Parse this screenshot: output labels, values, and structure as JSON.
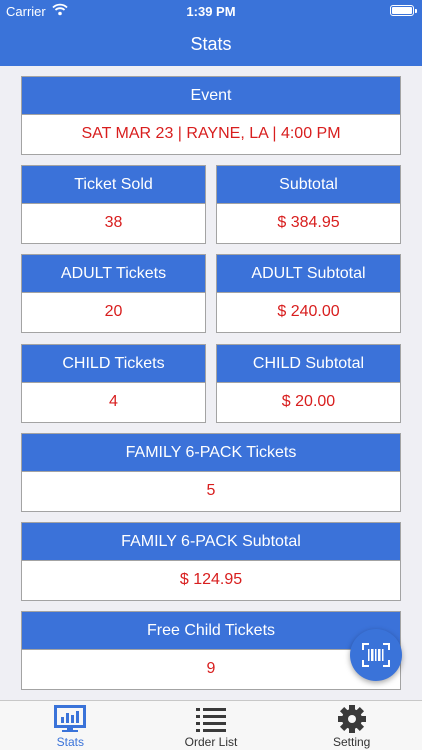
{
  "status_bar": {
    "carrier": "Carrier",
    "time": "1:39 PM"
  },
  "nav": {
    "title": "Stats"
  },
  "event": {
    "label": "Event",
    "value": "SAT MAR 23 | RAYNE, LA | 4:00 PM"
  },
  "stats": {
    "ticket_sold": {
      "label": "Ticket Sold",
      "value": "38"
    },
    "subtotal": {
      "label": "Subtotal",
      "value": "$ 384.95"
    },
    "adult_tickets": {
      "label": "ADULT Tickets",
      "value": "20"
    },
    "adult_subtotal": {
      "label": "ADULT Subtotal",
      "value": "$ 240.00"
    },
    "child_tickets": {
      "label": "CHILD Tickets",
      "value": "4"
    },
    "child_subtotal": {
      "label": "CHILD Subtotal",
      "value": "$ 20.00"
    },
    "family_tickets": {
      "label": "FAMILY 6-PACK Tickets",
      "value": "5"
    },
    "family_subtotal": {
      "label": "FAMILY 6-PACK Subtotal",
      "value": "$ 124.95"
    },
    "free_child_tickets": {
      "label": "Free Child Tickets",
      "value": "9"
    }
  },
  "fab": {
    "icon": "barcode-scan-icon"
  },
  "tabs": [
    {
      "label": "Stats",
      "icon": "stats-icon",
      "active": true
    },
    {
      "label": "Order List",
      "icon": "list-icon",
      "active": false
    },
    {
      "label": "Setting",
      "icon": "gear-icon",
      "active": false
    }
  ],
  "colors": {
    "accent": "#3a73d9",
    "value_red": "#d81e1e",
    "background": "#efeff4"
  }
}
